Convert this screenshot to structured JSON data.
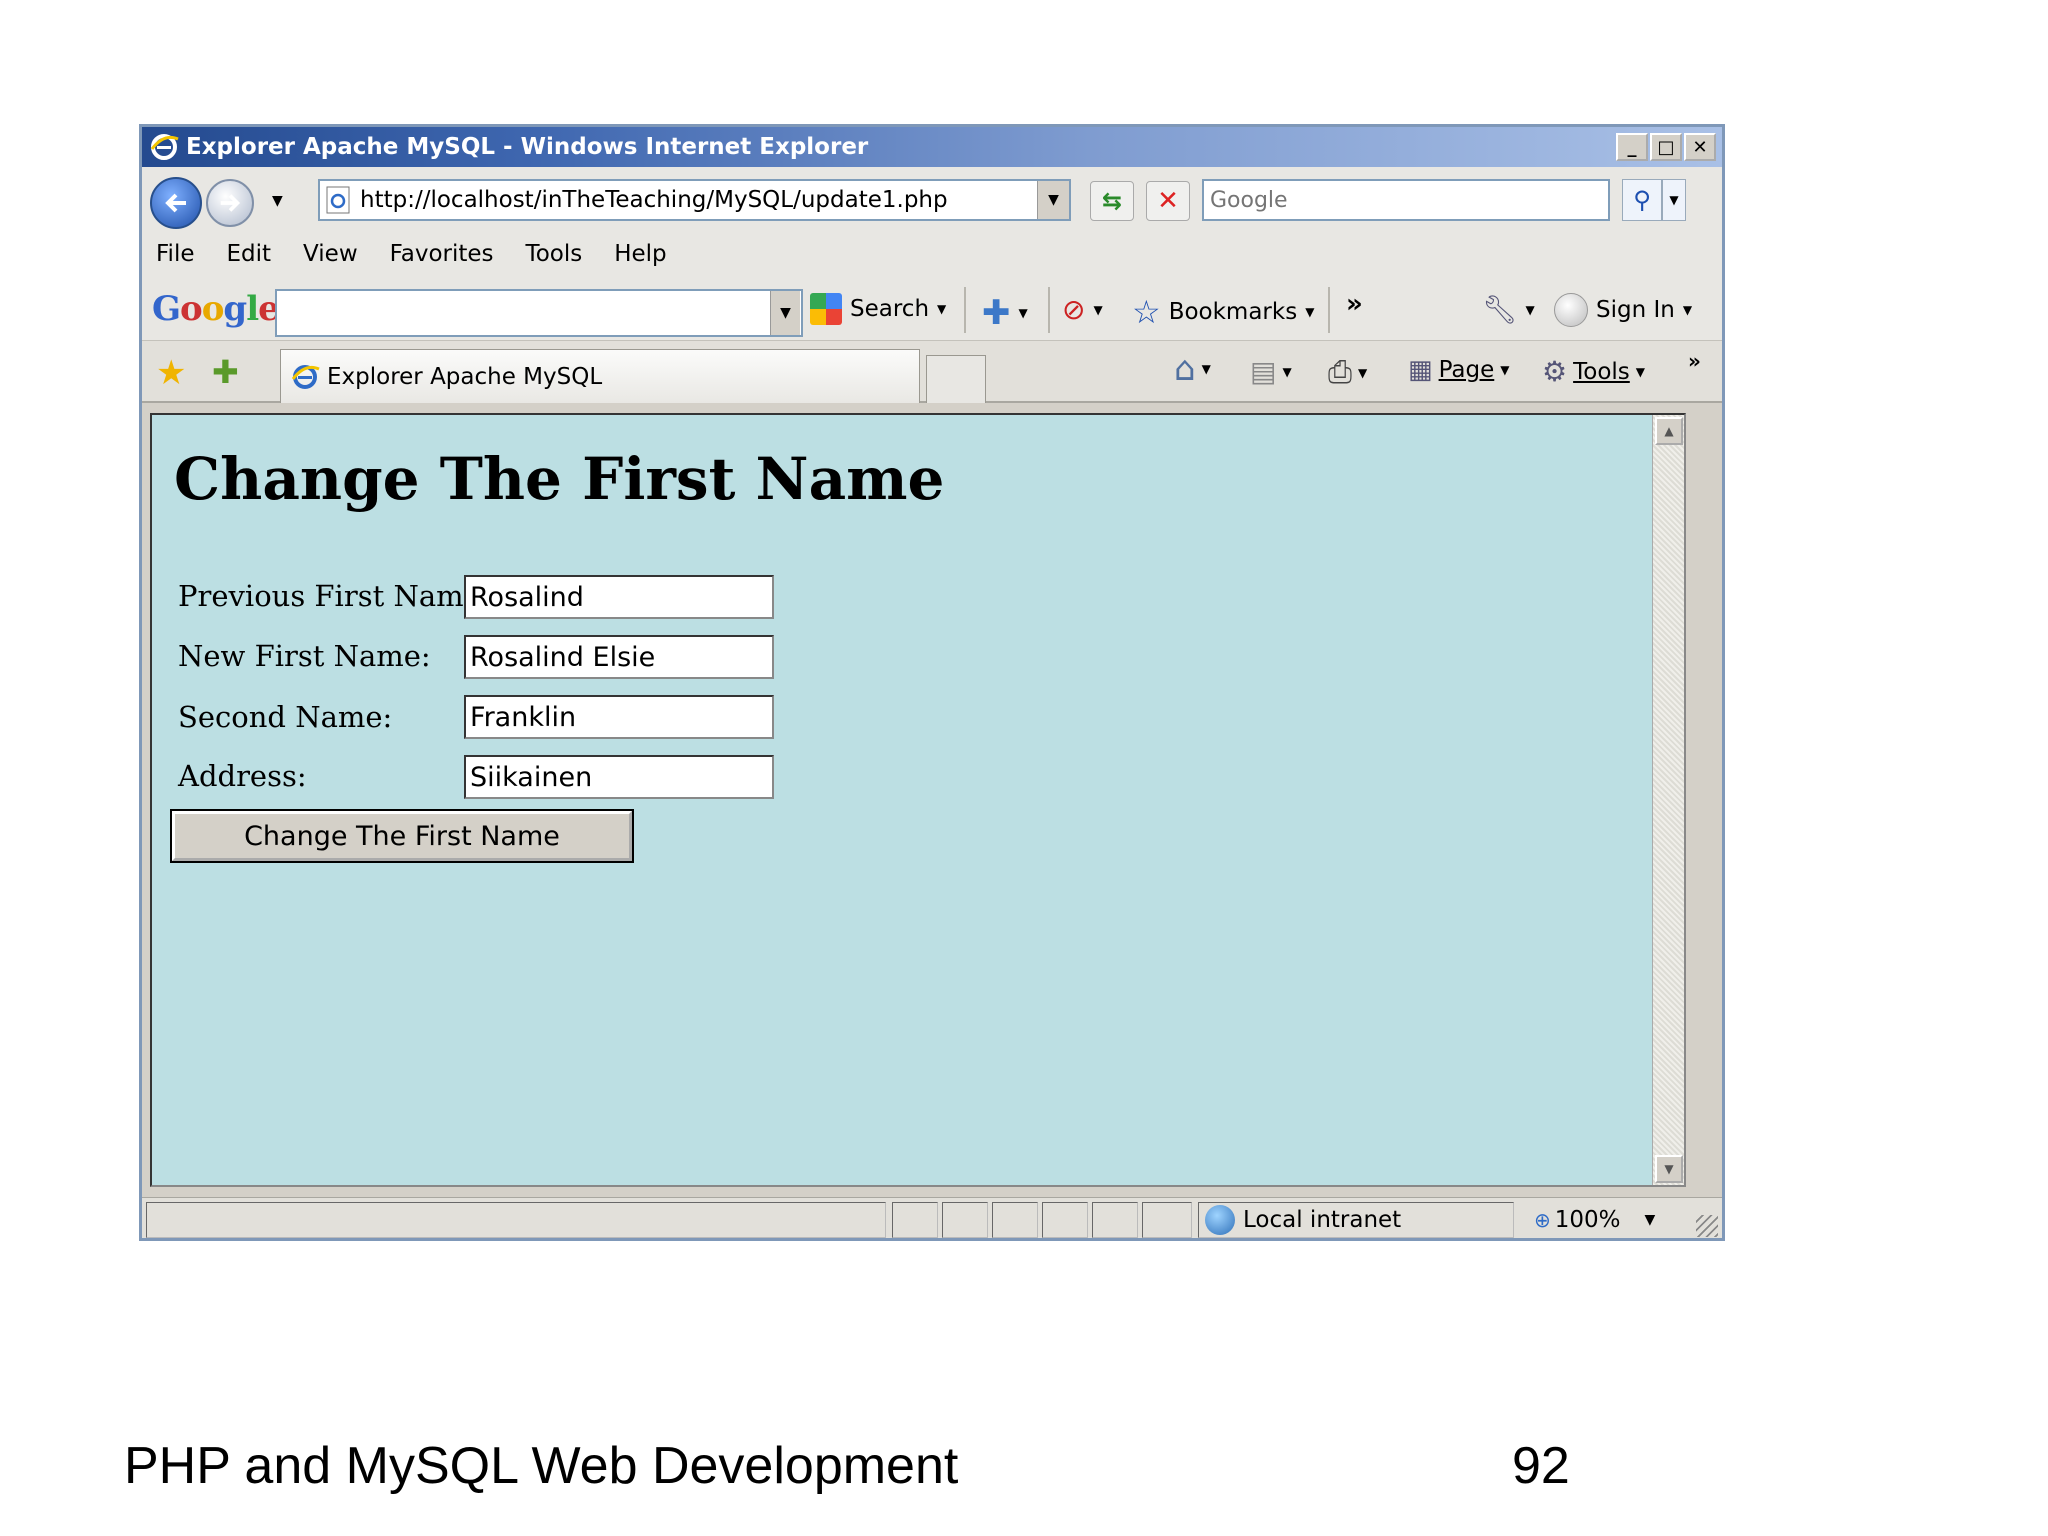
{
  "window": {
    "title": "Explorer Apache MySQL - Windows Internet Explorer",
    "controls": {
      "minimize": "_",
      "maximize": "□",
      "close": "✕"
    }
  },
  "address_bar": {
    "url": "http://localhost/inTheTeaching/MySQL/update1.php",
    "search_placeholder": "Google"
  },
  "menu": {
    "items": [
      "File",
      "Edit",
      "View",
      "Favorites",
      "Tools",
      "Help"
    ]
  },
  "google_toolbar": {
    "logo": [
      "G",
      "o",
      "o",
      "g",
      "l",
      "e"
    ],
    "search_label": "Search",
    "bookmarks_label": "Bookmarks",
    "more_label": "»",
    "signin_label": "Sign In"
  },
  "tabs": {
    "active_label": "Explorer Apache MySQL",
    "more_label": "»"
  },
  "command_bar": {
    "page_label": "Page",
    "tools_label": "Tools"
  },
  "content": {
    "heading": "Change The First Name",
    "form": {
      "previous_first_name": {
        "label": "Previous First Name:",
        "value": "Rosalind"
      },
      "new_first_name": {
        "label": "New First Name:",
        "value": "Rosalind Elsie"
      },
      "second_name": {
        "label": "Second Name:",
        "value": "Franklin"
      },
      "address": {
        "label": "Address:",
        "value": "Siikainen"
      },
      "submit_label": "Change The First Name"
    },
    "background_color": "#bcdfe3"
  },
  "status_bar": {
    "zone": "Local intranet",
    "zoom": "100%"
  },
  "slide_footer": {
    "left_text": "PHP and MySQL Web Development",
    "page_number": "92"
  }
}
